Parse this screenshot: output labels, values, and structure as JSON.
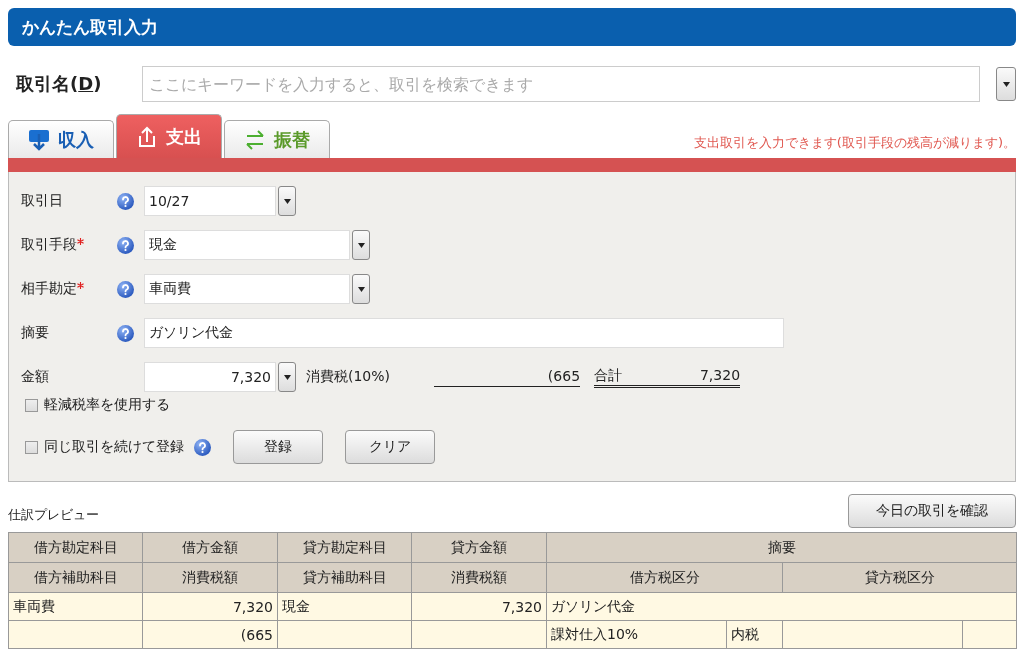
{
  "header": {
    "title": "かんたん取引入力"
  },
  "deal_name": {
    "label": "取引名(",
    "accesskey": "D",
    "label_end": ")",
    "placeholder": "ここにキーワードを入力すると、取引を検索できます"
  },
  "tabs": [
    {
      "kind": "income",
      "label": "収入",
      "selected": false
    },
    {
      "kind": "expense",
      "label": "支出",
      "selected": true
    },
    {
      "kind": "transfer",
      "label": "振替",
      "selected": false
    }
  ],
  "tab_hint": "支出取引を入力できます(取引手段の残高が減ります)。",
  "fields": [
    {
      "kind": "select",
      "label": "取引日",
      "required": false,
      "help": true,
      "value": "10/27"
    },
    {
      "kind": "select",
      "label": "取引手段",
      "required": true,
      "help": true,
      "value": "現金"
    },
    {
      "kind": "select",
      "label": "相手勘定",
      "required": true,
      "help": true,
      "value": "車両費"
    },
    {
      "kind": "text",
      "label": "摘要",
      "required": false,
      "help": true,
      "value": "ガソリン代金"
    }
  ],
  "amount": {
    "label": "金額",
    "value": "7,320",
    "tax_label": "消費税(10%)",
    "tax_value": "(665",
    "total_label": "合計",
    "total_value": "7,320"
  },
  "reduced_rate": {
    "label": "軽減税率を使用する",
    "checked": false
  },
  "repeat": {
    "label": "同じ取引を続けて登録",
    "checked": false,
    "help": true
  },
  "buttons": [
    "登録",
    "クリア"
  ],
  "preview": {
    "title": "仕訳プレビュー",
    "today_button": "今日の取引を確認",
    "header_rows": [
      [
        "借方勘定科目",
        "借方金額",
        "貸方勘定科目",
        "貸方金額",
        "摘要"
      ],
      [
        "借方補助科目",
        "消費税額",
        "貸方補助科目",
        "消費税額",
        "借方税区分",
        "貸方税区分"
      ]
    ],
    "rows": [
      [
        {
          "kind": "text",
          "text": "車両費"
        },
        {
          "kind": "amount",
          "text": "7,320"
        },
        {
          "kind": "text",
          "text": "現金"
        },
        {
          "kind": "amount",
          "text": "7,320"
        },
        {
          "kind": "text",
          "text": "ガソリン代金"
        },
        {
          "kind": "continued"
        },
        {
          "kind": "continued"
        },
        {
          "kind": "continued"
        }
      ],
      [
        {
          "kind": "text"
        },
        {
          "kind": "amount",
          "text": "(665"
        },
        {
          "kind": "text"
        },
        {
          "kind": "amount"
        },
        {
          "kind": "text",
          "text": "課対仕入10%"
        },
        {
          "kind": "text",
          "text": "内税"
        },
        {
          "kind": "text"
        },
        {
          "kind": "text"
        }
      ]
    ]
  }
}
